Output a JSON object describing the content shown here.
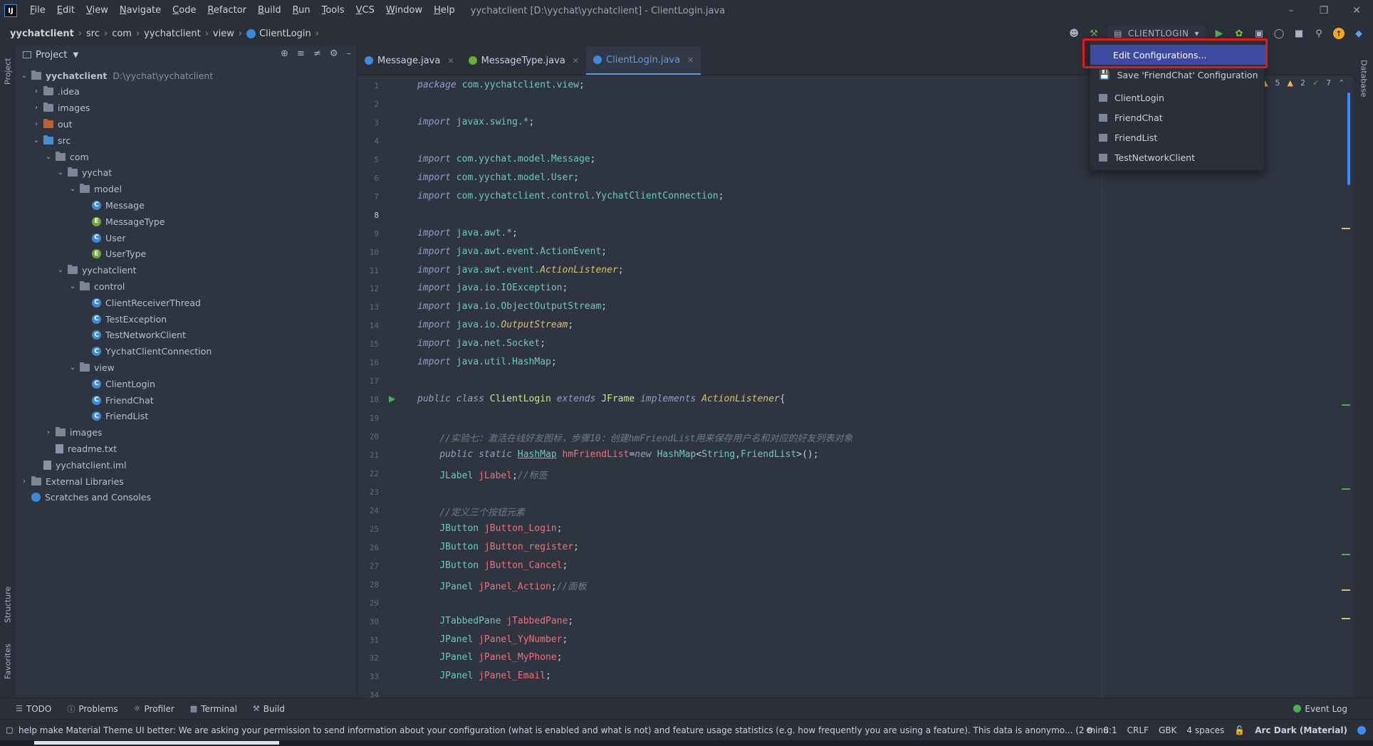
{
  "menubar": {
    "logo": "IJ",
    "items": [
      "File",
      "Edit",
      "View",
      "Navigate",
      "Code",
      "Refactor",
      "Build",
      "Run",
      "Tools",
      "VCS",
      "Window",
      "Help"
    ],
    "window_title": "yychatclient [D:\\yychat\\yychatclient] - ClientLogin.java"
  },
  "breadcrumb": [
    "yychatclient",
    "src",
    "com",
    "yychatclient",
    "view",
    "ClientLogin"
  ],
  "run_config": {
    "selected": "CLIENTLOGIN"
  },
  "left_strip": {
    "project_tab": "Project",
    "structure_tab": "Structure",
    "favorites_tab": "Favorites"
  },
  "right_strip": {
    "database_tab": "Database"
  },
  "project_panel": {
    "title": "Project",
    "tree": [
      {
        "label": "yychatclient",
        "extra": "D:\\yychat\\yychatclient",
        "depth": 0,
        "kind": "module",
        "expanded": true
      },
      {
        "label": ".idea",
        "depth": 1,
        "kind": "folder",
        "expanded": false
      },
      {
        "label": "images",
        "depth": 1,
        "kind": "folder",
        "expanded": false
      },
      {
        "label": "out",
        "depth": 1,
        "kind": "folder-orange",
        "expanded": false
      },
      {
        "label": "src",
        "depth": 1,
        "kind": "folder-blue",
        "expanded": true
      },
      {
        "label": "com",
        "depth": 2,
        "kind": "package",
        "expanded": true
      },
      {
        "label": "yychat",
        "depth": 3,
        "kind": "package",
        "expanded": true
      },
      {
        "label": "model",
        "depth": 4,
        "kind": "package",
        "expanded": true
      },
      {
        "label": "Message",
        "depth": 5,
        "kind": "class"
      },
      {
        "label": "MessageType",
        "depth": 5,
        "kind": "enum"
      },
      {
        "label": "User",
        "depth": 5,
        "kind": "class"
      },
      {
        "label": "UserType",
        "depth": 5,
        "kind": "enum"
      },
      {
        "label": "yychatclient",
        "depth": 3,
        "kind": "package",
        "expanded": true
      },
      {
        "label": "control",
        "depth": 4,
        "kind": "package",
        "expanded": true
      },
      {
        "label": "ClientReceiverThread",
        "depth": 5,
        "kind": "class"
      },
      {
        "label": "TestException",
        "depth": 5,
        "kind": "class"
      },
      {
        "label": "TestNetworkClient",
        "depth": 5,
        "kind": "class"
      },
      {
        "label": "YychatClientConnection",
        "depth": 5,
        "kind": "class"
      },
      {
        "label": "view",
        "depth": 4,
        "kind": "package",
        "expanded": true
      },
      {
        "label": "ClientLogin",
        "depth": 5,
        "kind": "class"
      },
      {
        "label": "FriendChat",
        "depth": 5,
        "kind": "class"
      },
      {
        "label": "FriendList",
        "depth": 5,
        "kind": "class"
      },
      {
        "label": "images",
        "depth": 2,
        "kind": "folder",
        "expanded": false
      },
      {
        "label": "readme.txt",
        "depth": 2,
        "kind": "file"
      },
      {
        "label": "yychatclient.iml",
        "depth": 1,
        "kind": "file"
      },
      {
        "label": "External Libraries",
        "depth": 0,
        "kind": "libraries",
        "expanded": false
      },
      {
        "label": "Scratches and Consoles",
        "depth": 0,
        "kind": "scratches"
      }
    ]
  },
  "editor": {
    "tabs": [
      {
        "label": "Message.java",
        "active": false,
        "icon": "class"
      },
      {
        "label": "MessageType.java",
        "active": false,
        "icon": "enum"
      },
      {
        "label": "ClientLogin.java",
        "active": true,
        "icon": "class"
      }
    ],
    "current_line": 8,
    "inspections": {
      "warnings": "5",
      "weak_warnings": "2",
      "typos": "7"
    },
    "lines": [
      {
        "n": "1",
        "html": "<span class='kw'>package</span> <span class='pkg'>com.yychatclient.view</span>;"
      },
      {
        "n": "2",
        "html": ""
      },
      {
        "n": "3",
        "html": "<span class='kw'>import</span> <span class='pkg'>javax.swing.*</span>;"
      },
      {
        "n": "4",
        "html": ""
      },
      {
        "n": "5",
        "html": "<span class='kw'>import</span> <span class='pkg'>com.yychat.model.Message</span>;"
      },
      {
        "n": "6",
        "html": "<span class='kw'>import</span> <span class='pkg'>com.yychat.model.User</span>;"
      },
      {
        "n": "7",
        "html": "<span class='kw'>import</span> <span class='pkg'>com.yychatclient.control.YychatClientConnection</span>;"
      },
      {
        "n": "8",
        "html": ""
      },
      {
        "n": "9",
        "html": "<span class='kw'>import</span> <span class='pkg'>java.awt.*</span>;"
      },
      {
        "n": "10",
        "html": "<span class='kw'>import</span> <span class='pkg'>java.awt.event.ActionEvent</span>;"
      },
      {
        "n": "11",
        "html": "<span class='kw'>import</span> <span class='pkg'>java.awt.event.</span><span class='iface'>ActionListener</span>;"
      },
      {
        "n": "12",
        "html": "<span class='kw'>import</span> <span class='pkg'>java.io.IOException</span>;"
      },
      {
        "n": "13",
        "html": "<span class='kw'>import</span> <span class='pkg'>java.io.ObjectOutputStream</span>;"
      },
      {
        "n": "14",
        "html": "<span class='kw'>import</span> <span class='pkg'>java.io.</span><span class='iface'>OutputStream</span>;"
      },
      {
        "n": "15",
        "html": "<span class='kw'>import</span> <span class='pkg'>java.net.Socket</span>;"
      },
      {
        "n": "16",
        "html": "<span class='kw'>import</span> <span class='pkg'>java.util.HashMap</span>;"
      },
      {
        "n": "17",
        "html": ""
      },
      {
        "n": "18",
        "html": "<span class='kw'>public class</span> <span class='cls-name'>ClientLogin</span> <span class='kw'>extends</span> <span class='cls-name'>JFrame</span> <span class='kw'>implements</span> <span class='iface'>ActionListener</span>{"
      },
      {
        "n": "19",
        "html": ""
      },
      {
        "n": "20",
        "html": "    <span class='cmt'>//实验七：激活在线好友图标，步骤10：创建hmFriendList用来保存用户名和对应的好友列表对象</span>"
      },
      {
        "n": "21",
        "html": "    <span class='kw'>public static</span> <span class='type under'>HashMap</span> <span class='var'>hmFriendList</span>=<span class='kw'>new</span> <span class='type'>HashMap</span>&lt;<span class='type'>String</span>,<span class='type'>FriendList</span>&gt;();"
      },
      {
        "n": "22",
        "html": "    <span class='type'>JLabel</span> <span class='var'>jLabel</span>;<span class='cmt'>//标签</span>"
      },
      {
        "n": "23",
        "html": ""
      },
      {
        "n": "24",
        "html": "    <span class='cmt'>//定义三个按钮元素</span>"
      },
      {
        "n": "25",
        "html": "    <span class='type'>JButton</span> <span class='var'>jButton_Login</span>;"
      },
      {
        "n": "26",
        "html": "    <span class='type'>JButton</span> <span class='var'>jButton_register</span>;"
      },
      {
        "n": "27",
        "html": "    <span class='type'>JButton</span> <span class='var'>jButton_Cancel</span>;"
      },
      {
        "n": "28",
        "html": "    <span class='type'>JPanel</span> <span class='var'>jPanel_Action</span>;<span class='cmt'>//面板</span>"
      },
      {
        "n": "29",
        "html": ""
      },
      {
        "n": "30",
        "html": "    <span class='type'>JTabbedPane</span> <span class='var'>jTabbedPane</span>;"
      },
      {
        "n": "31",
        "html": "    <span class='type'>JPanel</span> <span class='var'>jPanel_YyNumber</span>;"
      },
      {
        "n": "32",
        "html": "    <span class='type'>JPanel</span> <span class='var'>jPanel_MyPhone</span>;"
      },
      {
        "n": "33",
        "html": "    <span class='type'>JPanel</span> <span class='var'>jPanel_Email</span>;"
      },
      {
        "n": "34",
        "html": ""
      }
    ]
  },
  "run_dropdown": {
    "items": [
      "Edit Configurations...",
      "Save 'FriendChat' Configuration",
      "ClientLogin",
      "FriendChat",
      "FriendList",
      "TestNetworkClient"
    ]
  },
  "bottom_tabs": [
    "TODO",
    "Problems",
    "Profiler",
    "Terminal",
    "Build"
  ],
  "event_log": "Event Log",
  "status": {
    "message": "help make Material Theme UI better: We are asking your permission to send information about your configuration (what is enabled and what is not) and feature usage statistics (e.g. how frequently you are using a feature). This data is anonymo... (2 minutes ago)",
    "position": "8:1",
    "line_sep": "CRLF",
    "encoding": "GBK",
    "indent": "4 spaces",
    "theme": "Arc Dark (Material)"
  },
  "colors": {
    "accent": "#3d8bfd",
    "run_green": "#4caf50",
    "highlight_red": "#e21a1a",
    "selected_item": "#3d4aa0"
  }
}
